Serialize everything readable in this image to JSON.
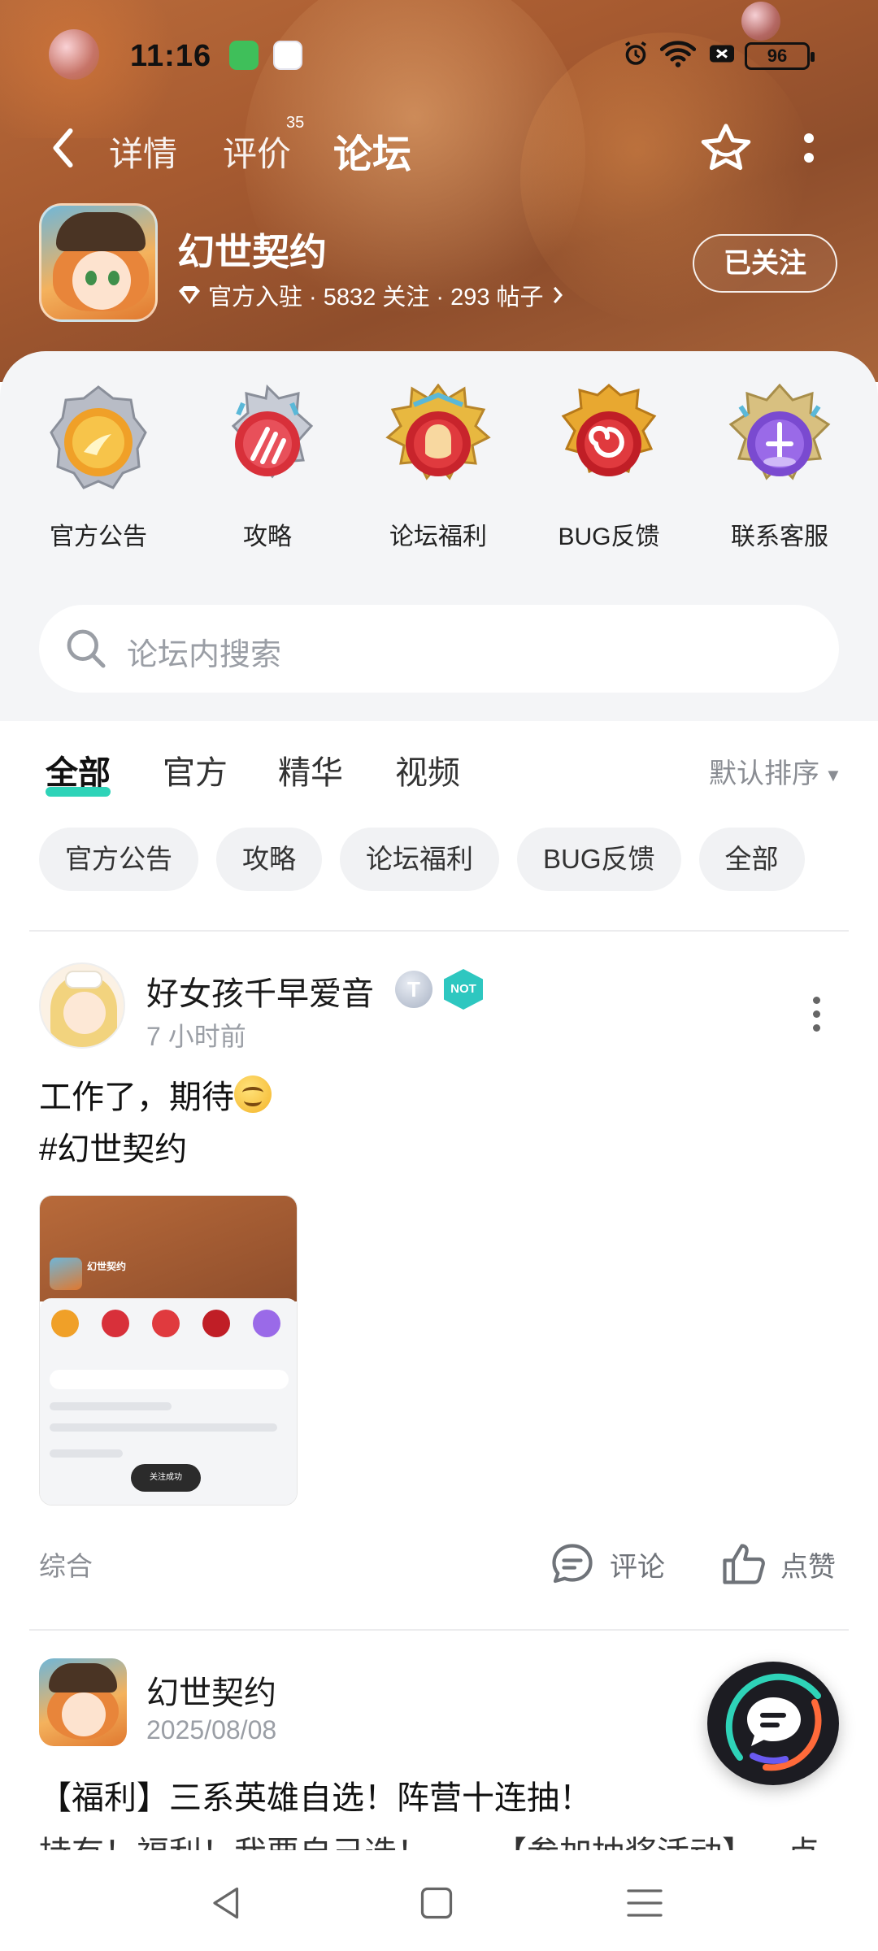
{
  "status_bar": {
    "time": "11:16",
    "battery": "96"
  },
  "nav": {
    "tabs": [
      {
        "label": "详情"
      },
      {
        "label": "评价"
      },
      {
        "label": "论坛"
      }
    ],
    "review_count": "35",
    "active_tab": "论坛"
  },
  "game": {
    "title": "幻世契约",
    "meta": "官方入驻 · 5832 关注 · 293 帖子",
    "follow_label": "已关注"
  },
  "categories": [
    {
      "label": "官方公告",
      "icon": "sun-medal-icon"
    },
    {
      "label": "攻略",
      "icon": "claw-medal-icon"
    },
    {
      "label": "论坛福利",
      "icon": "hero-medal-icon"
    },
    {
      "label": "BUG反馈",
      "icon": "spiral-medal-icon"
    },
    {
      "label": "联系客服",
      "icon": "crystal-medal-icon"
    }
  ],
  "search": {
    "placeholder": "论坛内搜索"
  },
  "filter_tabs": [
    {
      "label": "全部"
    },
    {
      "label": "官方"
    },
    {
      "label": "精华"
    },
    {
      "label": "视频"
    }
  ],
  "sort_label": "默认排序",
  "chips": [
    "官方公告",
    "攻略",
    "论坛福利",
    "BUG反馈",
    "全部"
  ],
  "posts": [
    {
      "author": "好女孩千早爱音",
      "level": "T",
      "badge": "NOT",
      "time": "7 小时前",
      "line1": "工作了，期待",
      "line2": "#幻世契约",
      "thumb": {
        "title": "幻世契约",
        "toast": "关注成功"
      },
      "tag": "综合",
      "comment_label": "评论",
      "like_label": "点赞"
    },
    {
      "author": "幻世契约",
      "time": "2025/08/08",
      "title": "【福利】三系英雄自选！阵营十连抽！",
      "preview": "持有！福利！我要自己选！——【参加抽奖活动】→点"
    }
  ],
  "colors": {
    "accent": "#2ed3b8",
    "banner": "#a65a30"
  }
}
